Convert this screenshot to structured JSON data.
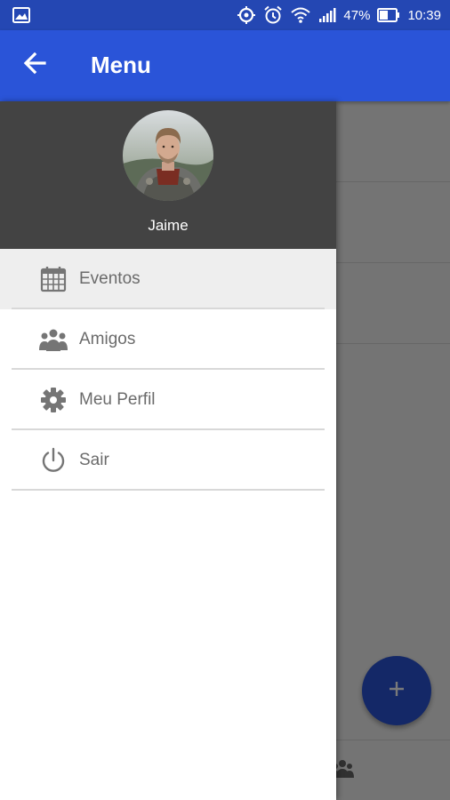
{
  "status_bar": {
    "battery": "47%",
    "time": "10:39",
    "icons": [
      "gallery-icon",
      "sync-icon",
      "alarm-icon",
      "wifi-icon",
      "signal-icon",
      "battery-icon"
    ]
  },
  "app_bar": {
    "title": "Menu",
    "back_icon": "arrow-left-icon",
    "color": "#2a54d8"
  },
  "drawer": {
    "header": {
      "user_name": "Jaime",
      "background": "#434343"
    },
    "items": [
      {
        "label": "Eventos",
        "icon": "calendar-icon",
        "active": true
      },
      {
        "label": "Amigos",
        "icon": "people-icon",
        "active": false
      },
      {
        "label": "Meu Perfil",
        "icon": "gear-icon",
        "active": false
      },
      {
        "label": "Sair",
        "icon": "power-icon",
        "active": false
      }
    ]
  },
  "fab": {
    "icon": "plus-icon"
  },
  "colors": {
    "primary": "#2a54d8",
    "status_bar": "#2447b3",
    "menu_text": "#6b6b6b"
  }
}
